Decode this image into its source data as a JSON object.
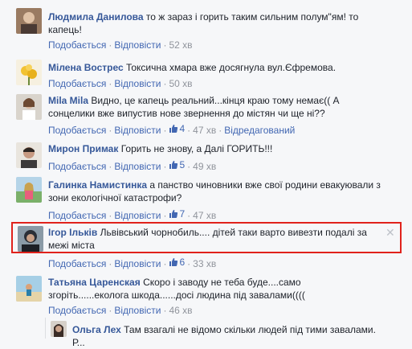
{
  "comments": [
    {
      "name": "Людмила Данилова",
      "text1": "то ж зараз і горить таким сильним полум\"ям! то",
      "text2": "капець!",
      "like": "Подобається",
      "reply": "Відповісти",
      "time": "52 хв",
      "likes": "",
      "edited": ""
    },
    {
      "name": "Мілена Вострес",
      "text1": "Токсична хмара вже досягнула вул.Єфремова.",
      "text2": "",
      "like": "Подобається",
      "reply": "Відповісти",
      "time": "50 хв",
      "likes": "",
      "edited": ""
    },
    {
      "name": "Mila Mila",
      "text1": "Видно, це капець реальний...кінця краю тому немає(( А",
      "text2": "сонцелики вже випустив нове звернення до містян чи ще ні??",
      "like": "Подобається",
      "reply": "Відповісти",
      "time": "47 хв",
      "likes": "4",
      "edited": "Відредагований"
    },
    {
      "name": "Мирон Примак",
      "text1": "Горить не знову, а Далі ГОРИТЬ!!!",
      "text2": "",
      "like": "Подобається",
      "reply": "Відповісти",
      "time": "49 хв",
      "likes": "5",
      "edited": ""
    },
    {
      "name": "Галинка Намистинка",
      "text1": "а панство чиновники вже свої родини евакуювали з",
      "text2": "зони екологічної катастрофи?",
      "like": "Подобається",
      "reply": "Відповісти",
      "time": "47 хв",
      "likes": "7",
      "edited": ""
    },
    {
      "name": "Ігор Ільків",
      "text1": "Львівський чорнобиль.... дітей таки варто вивезти подалі за",
      "text2": "межі міста",
      "like": "Подобається",
      "reply": "Відповісти",
      "time": "33 хв",
      "likes": "6",
      "edited": ""
    },
    {
      "name": "Татьяна Царенская",
      "text1": "Скоро і заводу не теба буде....само",
      "text2": "згоріть......еколога шкода......досі людина під завалами((((",
      "like": "Подобається",
      "reply": "Відповісти",
      "time": "46 хв",
      "likes": "",
      "edited": ""
    }
  ],
  "reply": {
    "name": "Ольга Лех",
    "text1": "Там взагалі не відомо скільки людей під тими завалами.",
    "text2": "Р..."
  },
  "ui": {
    "close": "✕",
    "sep": "·"
  },
  "colors": {
    "link": "#365899",
    "meta_link": "#4267b2",
    "highlight": "#e0221c"
  }
}
